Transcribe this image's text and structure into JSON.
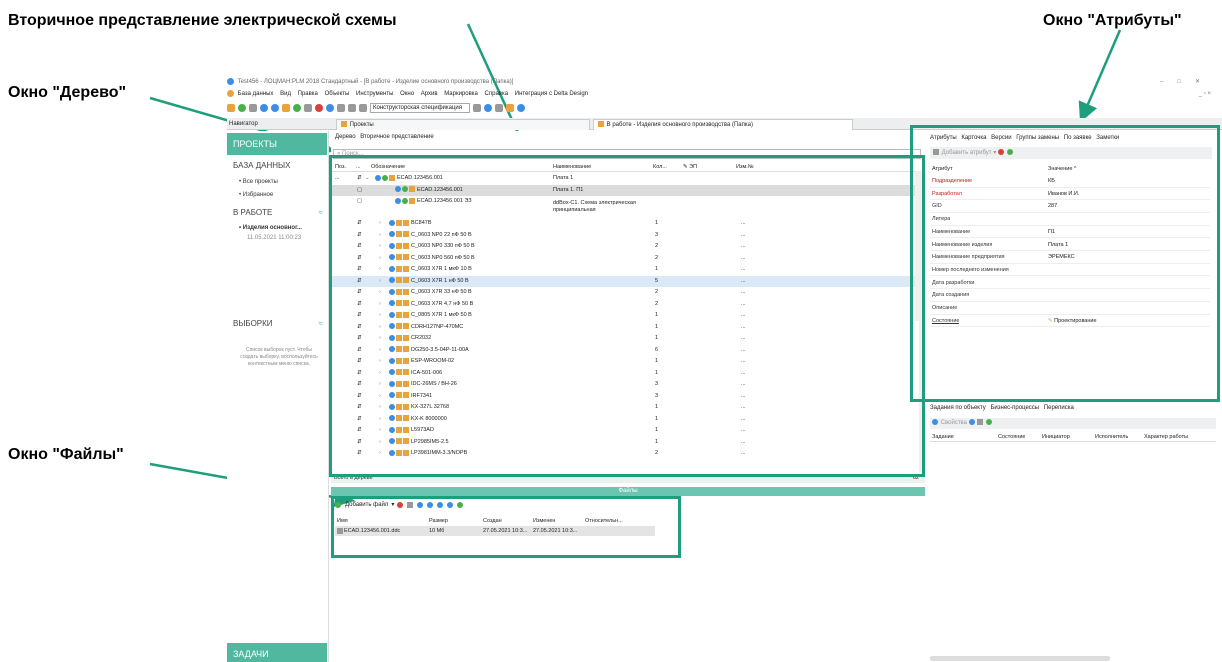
{
  "callouts": {
    "secondary": "Вторичное представление электрической схемы",
    "attributes": "Окно \"Атрибуты\"",
    "tree": "Окно \"Дерево\"",
    "files": "Окно \"Файлы\""
  },
  "window": {
    "title": "Test456 - ЛОЦМАН:PLM 2018 Стандартный - [В работе - Изделие основного производства (Папка)]"
  },
  "menu": [
    "База данных",
    "Вид",
    "Правка",
    "Объекты",
    "Инструменты",
    "Окно",
    "Архив",
    "Маркировка",
    "Справка",
    "Интеграция с Delta Design"
  ],
  "toolbar": {
    "combo": "Конструкторская спецификация"
  },
  "tabs": {
    "navigator": "Навигатор",
    "projects": "Проекты",
    "in_work": "В работе - Изделия основного производства (Папка)"
  },
  "sidebar": {
    "projects": "ПРОЕКТЫ",
    "database": "БАЗА ДАННЫХ",
    "all_projects": "Все проекты",
    "favorites": "Избранное",
    "in_work": "В РАБОТЕ",
    "work_item": "Изделия основног...",
    "work_date": "11.05.2021 11:00:23",
    "selections": "ВЫБОРКИ",
    "selections_hint": "Список выборок пуст. Чтобы создать выборку, воспользуйтесь контекстным меню списка.",
    "tasks": "ЗАДАЧИ"
  },
  "tree": {
    "tab_tree": "Дерево",
    "tab_secondary": "Вторичное представление",
    "search_placeholder": "Поиск...",
    "headers": {
      "pos": "Поз.",
      "dots": "...",
      "designation": "Обозначение",
      "name": "Наименование",
      "qty": "Кол...",
      "ep": "ЭП",
      "change": "Изм.№"
    },
    "rows": [
      {
        "pos": "...",
        "designation": "ECAD.123456.001",
        "name": "Плата 1",
        "qty": "",
        "dash": ""
      },
      {
        "pos": "",
        "designation": "ECAD.123456.001",
        "name": "Плата 1. П1",
        "qty": "",
        "dash": ""
      },
      {
        "pos": "",
        "designation": "ECAD.123456.001 ЭЗ",
        "name": "ddBox-C1. Схема электрическая принципиальная",
        "qty": "",
        "dash": ""
      },
      {
        "pos": "",
        "designation": "BC847B",
        "name": "",
        "qty": "1",
        "dash": "..."
      },
      {
        "pos": "",
        "designation": "C_0603 NP0 22 пФ 50 В",
        "name": "",
        "qty": "3",
        "dash": "..."
      },
      {
        "pos": "",
        "designation": "C_0603 NP0 330 пФ 50 В",
        "name": "",
        "qty": "2",
        "dash": "..."
      },
      {
        "pos": "",
        "designation": "C_0603 NP0 560 пФ 50 В",
        "name": "",
        "qty": "2",
        "dash": "..."
      },
      {
        "pos": "",
        "designation": "C_0603 X7R 1 мкФ 10 В",
        "name": "",
        "qty": "1",
        "dash": "..."
      },
      {
        "pos": "",
        "designation": "C_0603 X7R 1 нФ 50 В",
        "name": "",
        "qty": "5",
        "dash": "..."
      },
      {
        "pos": "",
        "designation": "C_0603 X7R 33 нФ 50 В",
        "name": "",
        "qty": "2",
        "dash": "..."
      },
      {
        "pos": "",
        "designation": "C_0603 X7R 4,7 нФ 50 В",
        "name": "",
        "qty": "2",
        "dash": "..."
      },
      {
        "pos": "",
        "designation": "C_0805 X7R 1 мкФ 50 В",
        "name": "",
        "qty": "1",
        "dash": "..."
      },
      {
        "pos": "",
        "designation": "CDRH127NP-470MC",
        "name": "",
        "qty": "1",
        "dash": "..."
      },
      {
        "pos": "",
        "designation": "CR2032",
        "name": "",
        "qty": "1",
        "dash": "..."
      },
      {
        "pos": "",
        "designation": "DG250-3.5-04P-11-00A",
        "name": "",
        "qty": "6",
        "dash": "..."
      },
      {
        "pos": "",
        "designation": "ESP-WROOM-02",
        "name": "",
        "qty": "1",
        "dash": "..."
      },
      {
        "pos": "",
        "designation": "ICA-501-006",
        "name": "",
        "qty": "1",
        "dash": "..."
      },
      {
        "pos": "",
        "designation": "IDC-26MS / BH-26",
        "name": "",
        "qty": "3",
        "dash": "..."
      },
      {
        "pos": "",
        "designation": "IRF7341",
        "name": "",
        "qty": "3",
        "dash": "..."
      },
      {
        "pos": "",
        "designation": "KX-327L 32768",
        "name": "",
        "qty": "1",
        "dash": "..."
      },
      {
        "pos": "",
        "designation": "KX-K 8000000",
        "name": "",
        "qty": "1",
        "dash": "..."
      },
      {
        "pos": "",
        "designation": "L5973AD",
        "name": "",
        "qty": "1",
        "dash": "..."
      },
      {
        "pos": "",
        "designation": "LP2985IM5-2.5",
        "name": "",
        "qty": "1",
        "dash": "..."
      },
      {
        "pos": "",
        "designation": "LP3981IMM-3.3/NOPB",
        "name": "",
        "qty": "2",
        "dash": "..."
      }
    ],
    "footer_label": "Всего в дереве",
    "footer_count": "62"
  },
  "files": {
    "title": "Файлы",
    "add_button": "Добавить файл",
    "headers": {
      "name": "Имя",
      "size": "Размер",
      "created": "Создан",
      "modified": "Изменен",
      "relative": "Относительн..."
    },
    "rows": [
      {
        "name": "ECAD.123456.001.ddc",
        "size": "10 Мб",
        "created": "27.05.2021 10:3...",
        "modified": "27.05.2021 10:3..."
      }
    ]
  },
  "attributes": {
    "tabs": [
      "Атрибуты",
      "Карточка",
      "Версии",
      "Группы замены",
      "По заявке",
      "Заметки"
    ],
    "add_button": "Добавить атрибут",
    "col_attr": "Атрибут",
    "col_value": "Значение",
    "rows": [
      {
        "name": "Подразделение",
        "value": "КБ",
        "red": true
      },
      {
        "name": "Разработал",
        "value": "Иванов И.И.",
        "red": true
      },
      {
        "name": "GID",
        "value": "287",
        "red": false
      },
      {
        "name": "Литера",
        "value": "",
        "red": false
      },
      {
        "name": "Наименование",
        "value": "П1",
        "red": false
      },
      {
        "name": "Наименование изделия",
        "value": "Плата 1",
        "red": false
      },
      {
        "name": "Наименование предприятия",
        "value": "ЭРЕМЕКС",
        "red": false
      },
      {
        "name": "Номер последнего изменения",
        "value": "",
        "red": false
      },
      {
        "name": "Дата разработки",
        "value": "",
        "red": false
      },
      {
        "name": "Дата создания",
        "value": "",
        "red": false
      },
      {
        "name": "Описание",
        "value": "",
        "red": false
      },
      {
        "name": "Состояние",
        "value": "Проектирование",
        "red": false
      }
    ]
  },
  "tasks": {
    "tabs": [
      "Задания по объекту",
      "Бизнес-процессы",
      "Переписка"
    ],
    "properties": "Свойства",
    "headers": [
      "Задание",
      "Состояние",
      "Инициатор",
      "Исполнитель",
      "Характер работы"
    ]
  },
  "colors": {
    "accent": "#1e9e7c",
    "sidebar": "#4fb89f",
    "selected": "#dcdcdc",
    "highlight": "#dbe9f7"
  }
}
